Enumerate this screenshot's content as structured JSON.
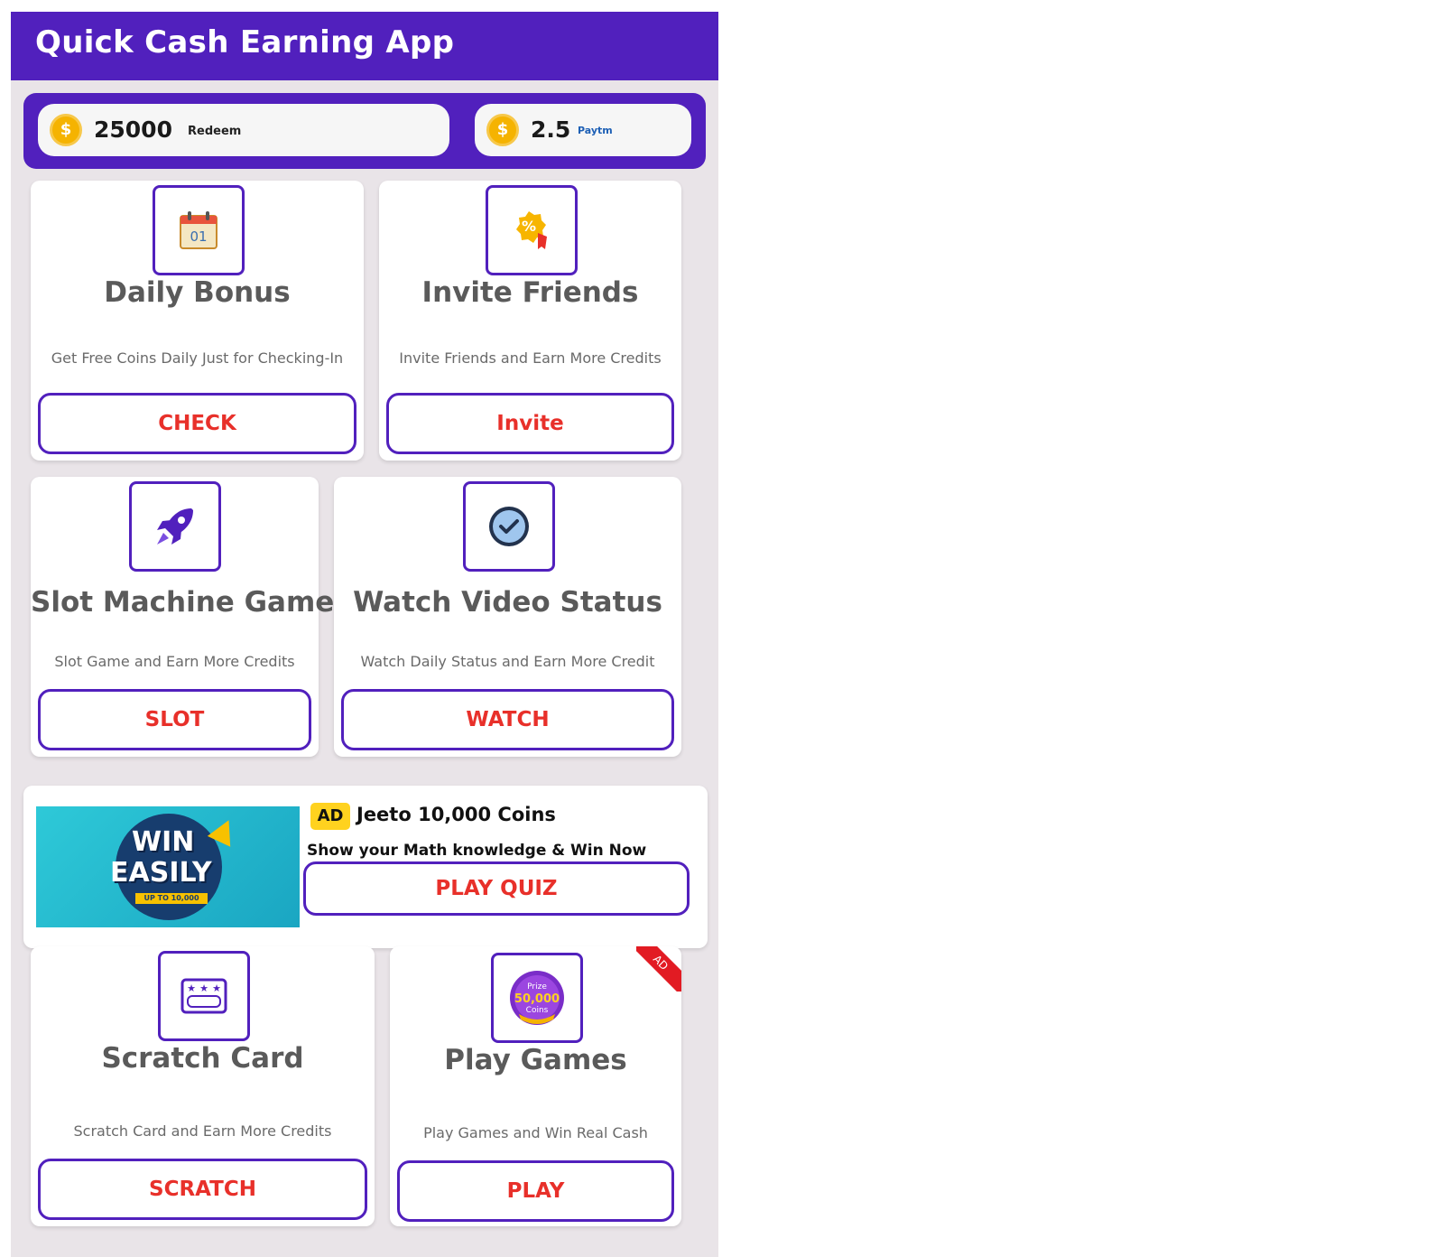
{
  "appbar": {
    "title": "Quick Cash Earning App"
  },
  "wallet": {
    "coins": "25000",
    "coins_action": "Redeem",
    "cash": "2.5",
    "cash_provider": "Paytm",
    "coin_symbol": "$"
  },
  "cards": {
    "daily": {
      "title": "Daily Bonus",
      "desc": "Get Free Coins Daily Just for Checking-In",
      "button": "CHECK",
      "icon": "calendar-icon",
      "icon_text": "01"
    },
    "invite": {
      "title": "Invite Friends",
      "desc": "Invite Friends and Earn More Credits",
      "button": "Invite",
      "icon": "discount-tag-icon"
    },
    "slot": {
      "title": "Slot Machine Game",
      "desc": "Slot Game and Earn More Credits",
      "button": "SLOT",
      "icon": "rocket-icon"
    },
    "watch": {
      "title": "Watch Video Status",
      "desc": "Watch Daily Status and Earn More Credit",
      "button": "WATCH",
      "icon": "verified-badge-icon"
    },
    "scratch": {
      "title": "Scratch Card",
      "desc": "Scratch Card and Earn More Credits",
      "button": "SCRATCH",
      "icon": "scratch-card-icon"
    },
    "games": {
      "title": "Play Games",
      "desc": "Play Games and Win Real Cash",
      "button": "PLAY",
      "icon": "prize-coins-icon",
      "ribbon": "AD",
      "icon_line1": "Prize",
      "icon_line2": "50,000",
      "icon_line3": "Coins"
    }
  },
  "ad": {
    "badge": "AD",
    "title": "Jeeto 10,000 Coins",
    "subtitle": "Show your Math knowledge & Win Now",
    "button": "PLAY QUIZ",
    "banner_line1": "WIN",
    "banner_line2": "EASILY",
    "banner_strip": "UP TO 10,000"
  },
  "colors": {
    "primary": "#5120bd",
    "accent": "#e8302a",
    "background": "#e9e4e8",
    "coin": "#f5b301"
  }
}
